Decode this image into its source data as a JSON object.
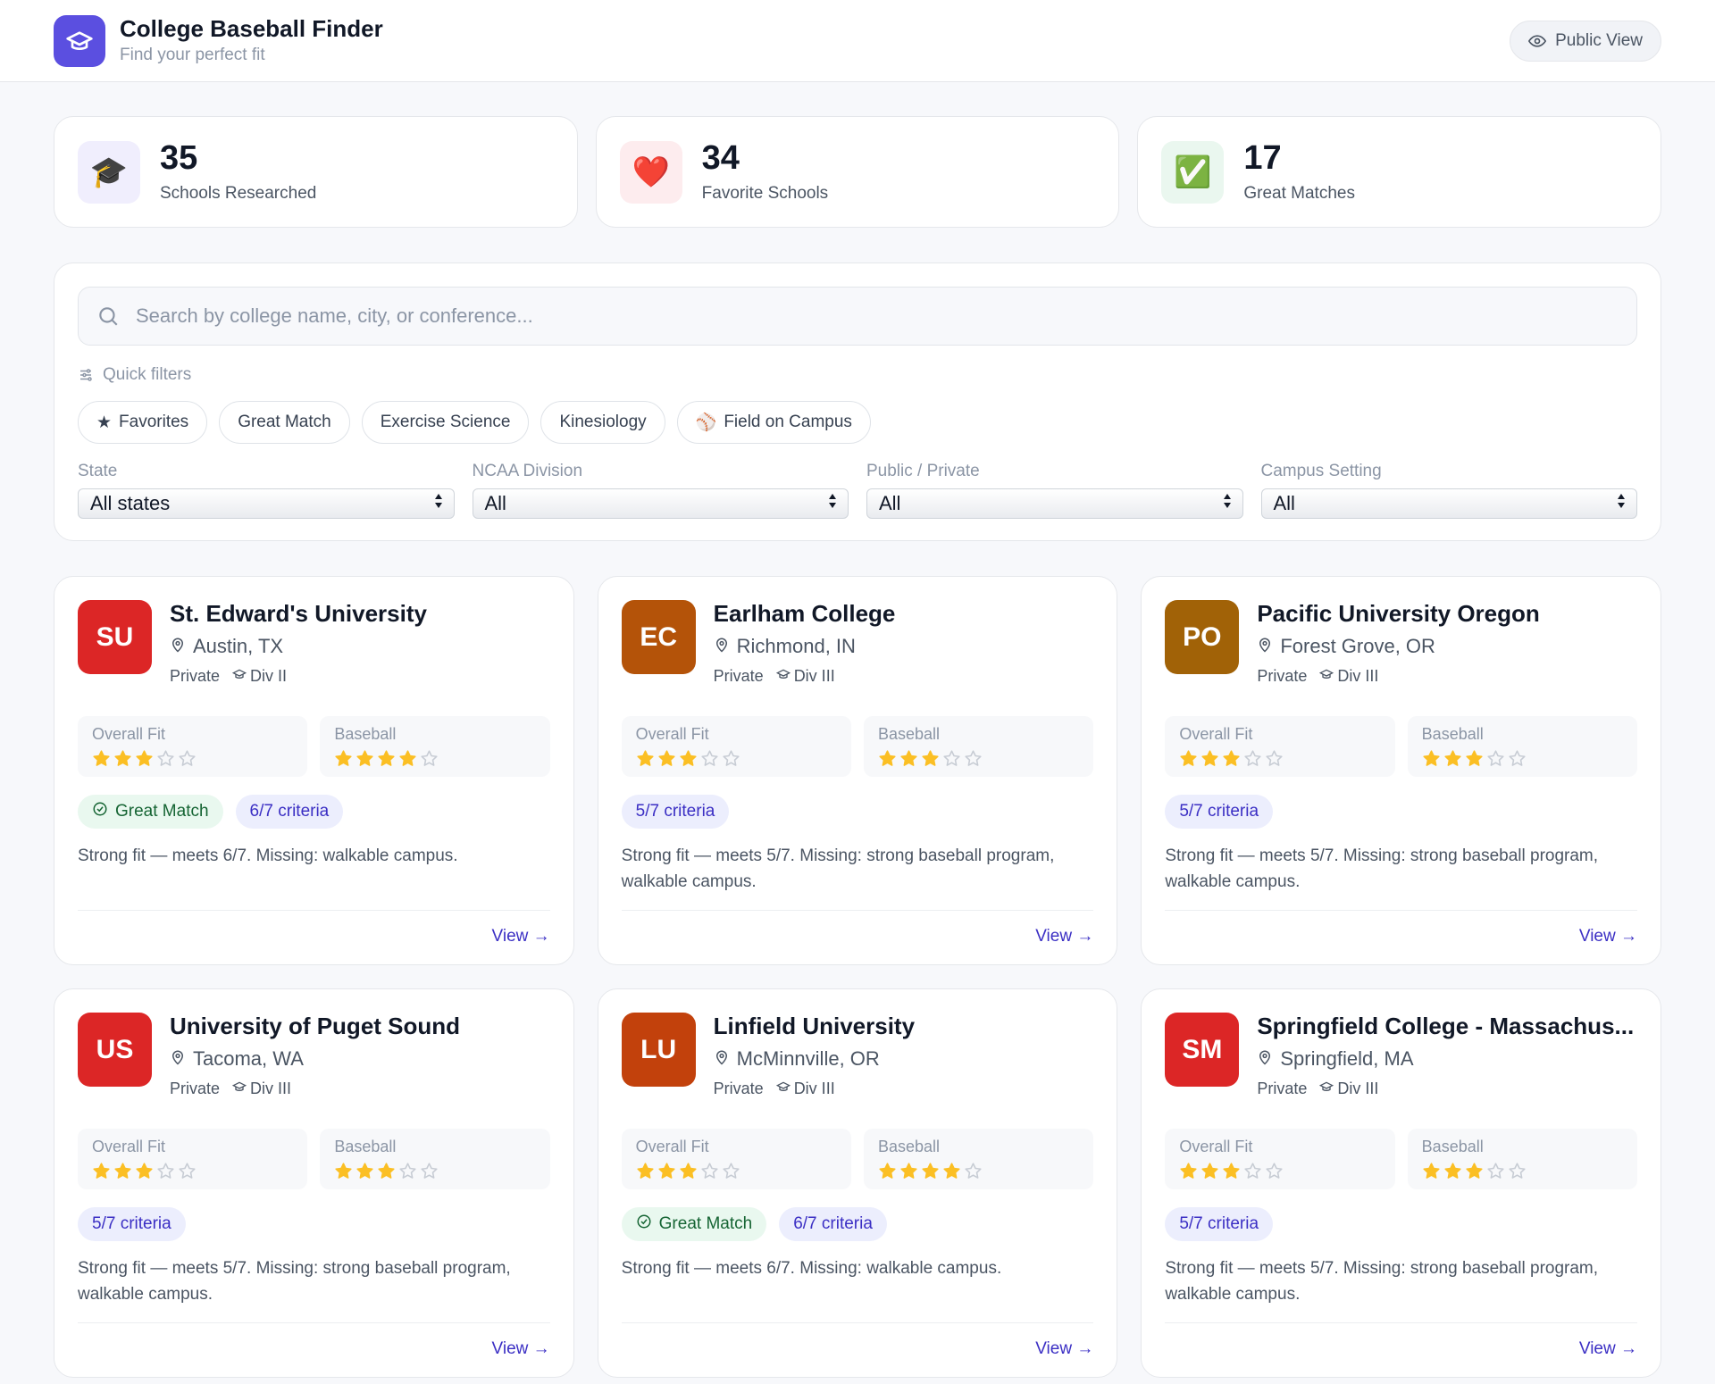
{
  "header": {
    "title": "College Baseball Finder",
    "subtitle": "Find your perfect fit",
    "public_view_label": "Public View",
    "logo_icon": "graduation-cap-icon",
    "brand_color": "#5b4fe0"
  },
  "stats": [
    {
      "value": "35",
      "label": "Schools Researched",
      "icon": "🎓",
      "bg": "#f0eefd"
    },
    {
      "value": "34",
      "label": "Favorite Schools",
      "icon": "❤️",
      "bg": "#fdecee"
    },
    {
      "value": "17",
      "label": "Great Matches",
      "icon": "✅",
      "bg": "#eaf7ef"
    }
  ],
  "search": {
    "placeholder": "Search by college name, city, or conference..."
  },
  "quick_filters": {
    "label": "Quick filters",
    "chips": [
      {
        "label": "Favorites",
        "prefix": "★"
      },
      {
        "label": "Great Match",
        "prefix": ""
      },
      {
        "label": "Exercise Science",
        "prefix": ""
      },
      {
        "label": "Kinesiology",
        "prefix": ""
      },
      {
        "label": "Field on Campus",
        "prefix": "⚾"
      }
    ]
  },
  "selects": [
    {
      "label": "State",
      "value": "All states"
    },
    {
      "label": "NCAA Division",
      "value": "All"
    },
    {
      "label": "Public / Private",
      "value": "All"
    },
    {
      "label": "Campus Setting",
      "value": "All"
    }
  ],
  "rating_labels": {
    "overall": "Overall Fit",
    "baseball": "Baseball"
  },
  "view_label": "View →",
  "schools": [
    {
      "initials": "SU",
      "color": "#dc2626",
      "name": "St. Edward's University",
      "location": "Austin, TX",
      "type": "Private",
      "division": "Div II",
      "overall": 3,
      "baseball": 4,
      "great_match": "Great Match",
      "criteria": "6/7 criteria",
      "desc": "Strong fit — meets 6/7. Missing: walkable campus."
    },
    {
      "initials": "EC",
      "color": "#b45309",
      "name": "Earlham College",
      "location": "Richmond, IN",
      "type": "Private",
      "division": "Div III",
      "overall": 3,
      "baseball": 3,
      "great_match": "",
      "criteria": "5/7 criteria",
      "desc": "Strong fit — meets 5/7. Missing: strong baseball program, walkable campus."
    },
    {
      "initials": "PO",
      "color": "#a16207",
      "name": "Pacific University Oregon",
      "location": "Forest Grove, OR",
      "type": "Private",
      "division": "Div III",
      "overall": 3,
      "baseball": 3,
      "great_match": "",
      "criteria": "5/7 criteria",
      "desc": "Strong fit — meets 5/7. Missing: strong baseball program, walkable campus."
    },
    {
      "initials": "US",
      "color": "#dc2626",
      "name": "University of Puget Sound",
      "location": "Tacoma, WA",
      "type": "Private",
      "division": "Div III",
      "overall": 3,
      "baseball": 3,
      "great_match": "",
      "criteria": "5/7 criteria",
      "desc": "Strong fit — meets 5/7. Missing: strong baseball program, walkable campus."
    },
    {
      "initials": "LU",
      "color": "#c2410c",
      "name": "Linfield University",
      "location": "McMinnville, OR",
      "type": "Private",
      "division": "Div III",
      "overall": 3,
      "baseball": 4,
      "great_match": "Great Match",
      "criteria": "6/7 criteria",
      "desc": "Strong fit — meets 6/7. Missing: walkable campus."
    },
    {
      "initials": "SM",
      "color": "#dc2626",
      "name": "Springfield College - Massachus...",
      "location": "Springfield, MA",
      "type": "Private",
      "division": "Div III",
      "overall": 3,
      "baseball": 3,
      "great_match": "",
      "criteria": "5/7 criteria",
      "desc": "Strong fit — meets 5/7. Missing: strong baseball program, walkable campus."
    }
  ],
  "colors": {
    "star_filled": "#fbbf24",
    "star_empty": "#c7ccd4",
    "accent": "#3b2fc4"
  }
}
